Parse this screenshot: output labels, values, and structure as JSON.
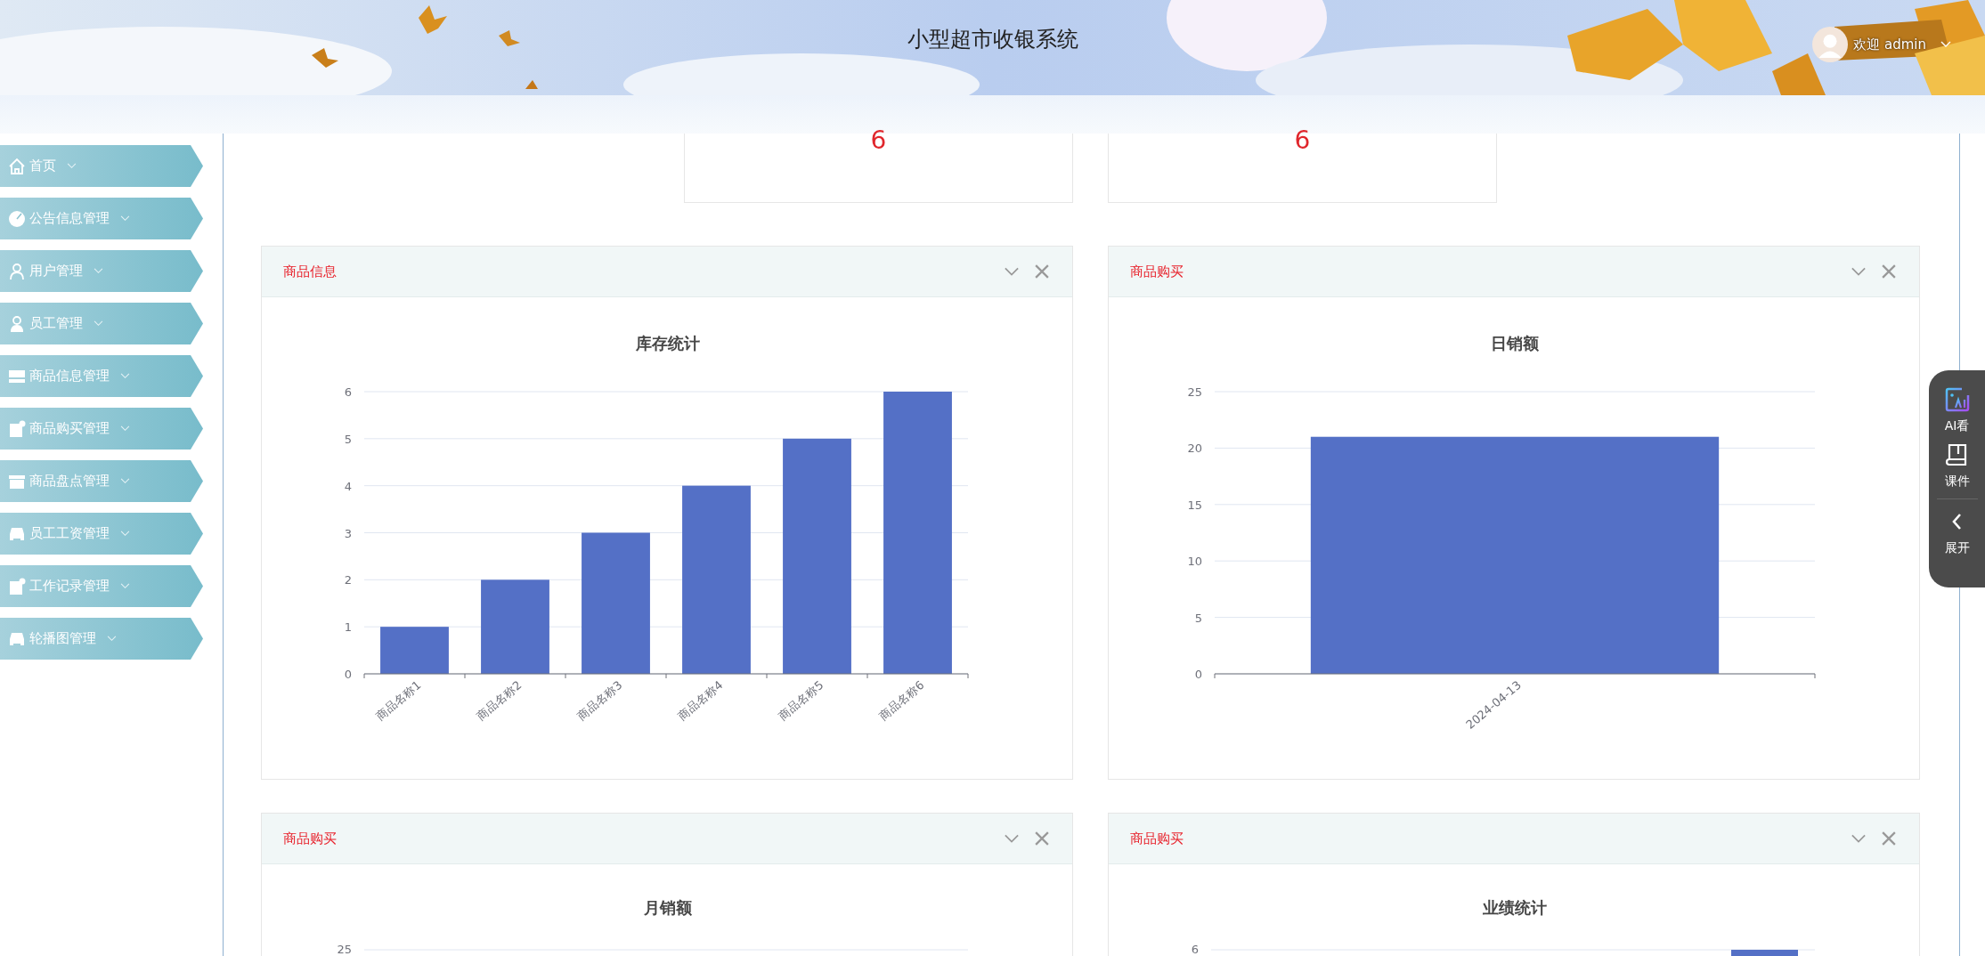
{
  "header": {
    "title": "小型超市收银系统",
    "user": "欢迎 admin"
  },
  "sidebar": {
    "items": [
      {
        "label": "首页",
        "kind": "home"
      },
      {
        "label": "公告信息管理",
        "kind": "pie"
      },
      {
        "label": "用户管理",
        "kind": "user"
      },
      {
        "label": "员工管理",
        "kind": "staff"
      },
      {
        "label": "商品信息管理",
        "kind": "card"
      },
      {
        "label": "商品购买管理",
        "kind": "doc"
      },
      {
        "label": "商品盘点管理",
        "kind": "box"
      },
      {
        "label": "员工工资管理",
        "kind": "car"
      },
      {
        "label": "工作记录管理",
        "kind": "doc"
      },
      {
        "label": "轮播图管理",
        "kind": "car"
      }
    ]
  },
  "stat_cards": [
    {
      "value": "6"
    },
    {
      "value": "6"
    }
  ],
  "panels": [
    {
      "title": "商品信息",
      "chart_data": {
        "type": "bar",
        "title": "库存统计",
        "categories": [
          "商品名称1",
          "商品名称2",
          "商品名称3",
          "商品名称4",
          "商品名称5",
          "商品名称6"
        ],
        "values": [
          1,
          2,
          3,
          4,
          5,
          6
        ],
        "grid": true,
        "ylim": [
          0,
          6
        ],
        "yticks": [
          0,
          1,
          2,
          3,
          4,
          5,
          6
        ]
      }
    },
    {
      "title": "商品购买",
      "chart_data": {
        "type": "bar",
        "title": "日销额",
        "categories": [
          "2024-04-13"
        ],
        "values": [
          21
        ],
        "grid": true,
        "ylim": [
          0,
          25
        ],
        "yticks": [
          0,
          5,
          10,
          15,
          20,
          25
        ]
      }
    },
    {
      "title": "商品购买",
      "chart_title": "月销额",
      "top_tick": "25",
      "bar_visible": false
    },
    {
      "title": "商品购买",
      "chart_title": "业绩统计",
      "top_tick": "6",
      "bar_visible": true
    }
  ],
  "float_toolbar": {
    "items": [
      {
        "label": "AI看",
        "kind": "ai"
      },
      {
        "label": "课件",
        "kind": "book"
      },
      {
        "label": "展开",
        "kind": "expand"
      }
    ]
  }
}
